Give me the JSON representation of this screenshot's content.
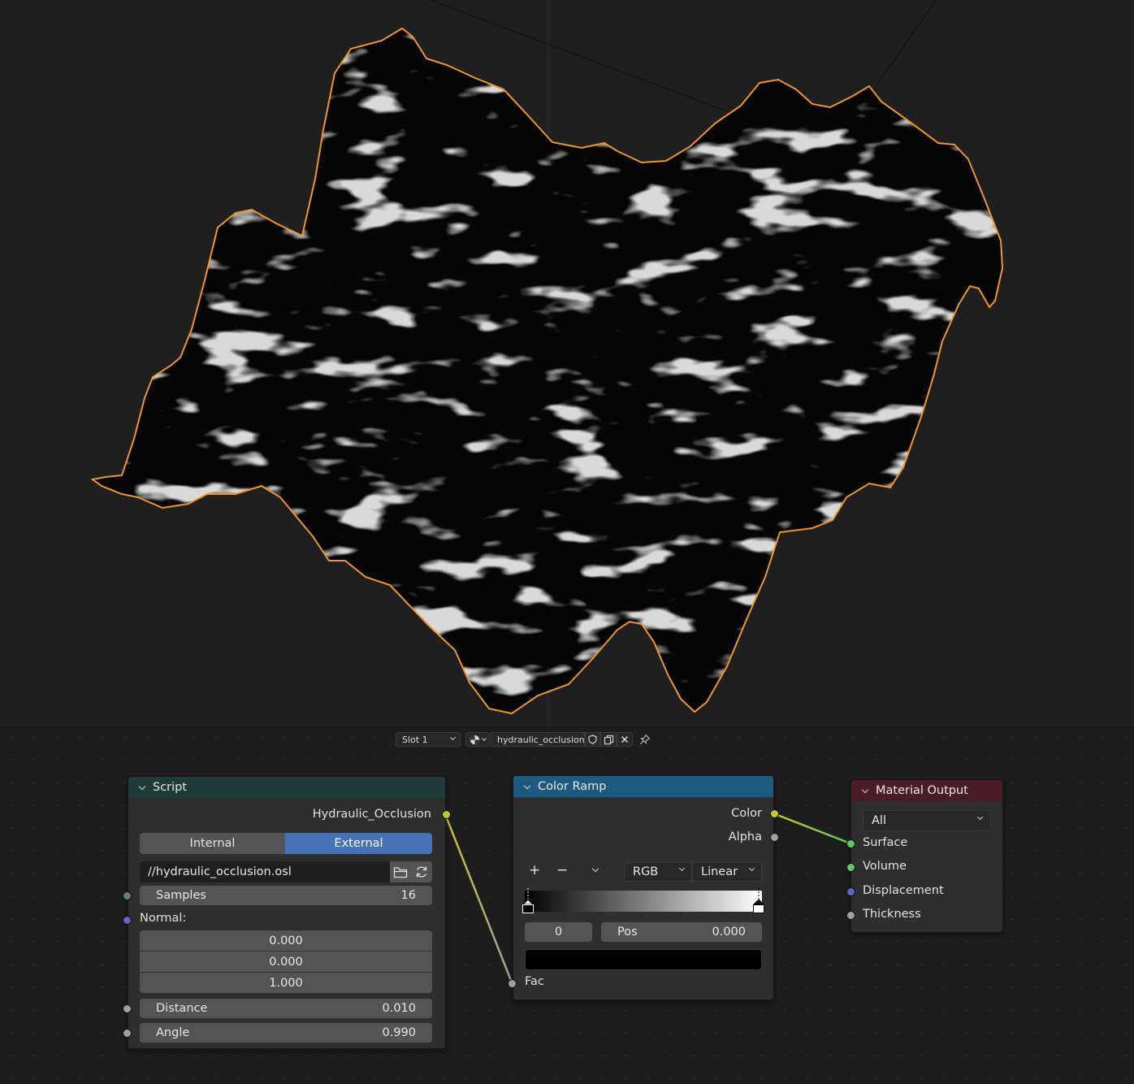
{
  "header": {
    "slot": "Slot 1",
    "material_name": "hydraulic_occlusion",
    "icons": [
      "material-sphere-icon",
      "shield-icon",
      "duplicate-icon",
      "close-icon",
      "pin-icon"
    ]
  },
  "nodes": {
    "script": {
      "title": "Script",
      "output": "Hydraulic_Occlusion",
      "mode_internal": "Internal",
      "mode_external": "External",
      "mode_selected": "External",
      "filepath": "//hydraulic_occlusion.osl",
      "samples_label": "Samples",
      "samples_value": "16",
      "normal_label": "Normal:",
      "normal_x": "0.000",
      "normal_y": "0.000",
      "normal_z": "1.000",
      "distance_label": "Distance",
      "distance_value": "0.010",
      "angle_label": "Angle",
      "angle_value": "0.990"
    },
    "color_ramp": {
      "title": "Color Ramp",
      "out_color": "Color",
      "out_alpha": "Alpha",
      "add": "+",
      "remove": "−",
      "color_mode": "RGB",
      "interpolation": "Linear",
      "stop_index": "0",
      "pos_label": "Pos",
      "pos_value": "0.000",
      "stop_color": "#000000",
      "in_fac": "Fac"
    },
    "material_output": {
      "title": "Material Output",
      "target": "All",
      "in_surface": "Surface",
      "in_volume": "Volume",
      "in_displacement": "Displacement",
      "in_thickness": "Thickness"
    }
  },
  "colors": {
    "selection_outline": "#f0952e",
    "script_header": "#1e3b3a",
    "color_ramp_header": "#1e5a80",
    "output_header": "#4a1c25",
    "socket_float": "#a1a1a1",
    "socket_color": "#c7c729",
    "socket_shader": "#63c763",
    "socket_vector": "#6363c7",
    "socket_int": "#598c5c",
    "accent_blue": "#4672b8"
  }
}
